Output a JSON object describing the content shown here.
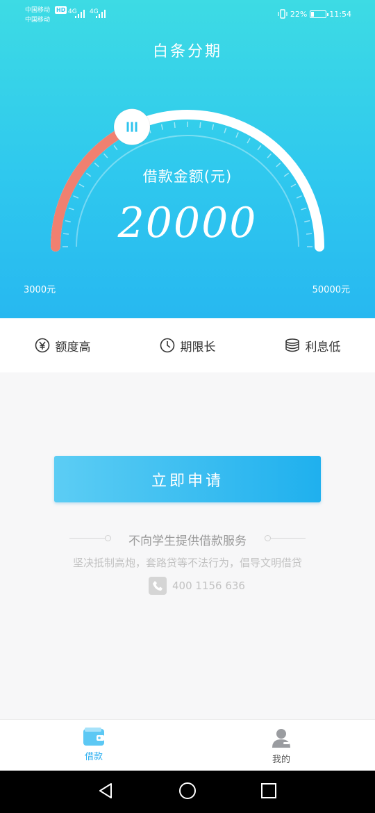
{
  "status_bar": {
    "carrier1": "中国移动",
    "carrier2": "中国移动",
    "hd": "HD",
    "net1": "4G",
    "net2": "4G",
    "battery_text": "22%",
    "battery_level": 0.22,
    "time": "11:54"
  },
  "header": {
    "title": "白条分期"
  },
  "gauge": {
    "label": "借款金额(元)",
    "value": "20000",
    "min_label": "3000元",
    "max_label": "50000元",
    "min": 3000,
    "max": 50000,
    "current": 20000,
    "fill_color": "#f08070",
    "track_color": "#ffffff",
    "handle_glyph": "III"
  },
  "features": [
    {
      "icon": "yen-icon",
      "label": "额度高"
    },
    {
      "icon": "clock-icon",
      "label": "期限长"
    },
    {
      "icon": "coins-icon",
      "label": "利息低"
    }
  ],
  "apply_button": "立即申请",
  "notice": {
    "title": "不向学生提供借款服务",
    "subtitle": "坚决抵制高炮，套路贷等不法行为，倡导文明借贷",
    "hotline": "400 1156 636",
    "hotline_icon": "phone-icon"
  },
  "tabbar": {
    "tabs": [
      {
        "label": "借款",
        "icon": "wallet-icon",
        "active": true
      },
      {
        "label": "我的",
        "icon": "user-icon",
        "active": false
      }
    ],
    "active_color": "#2aaef0"
  },
  "system_nav": {
    "icons": [
      "back-icon",
      "home-icon",
      "recents-icon"
    ]
  }
}
